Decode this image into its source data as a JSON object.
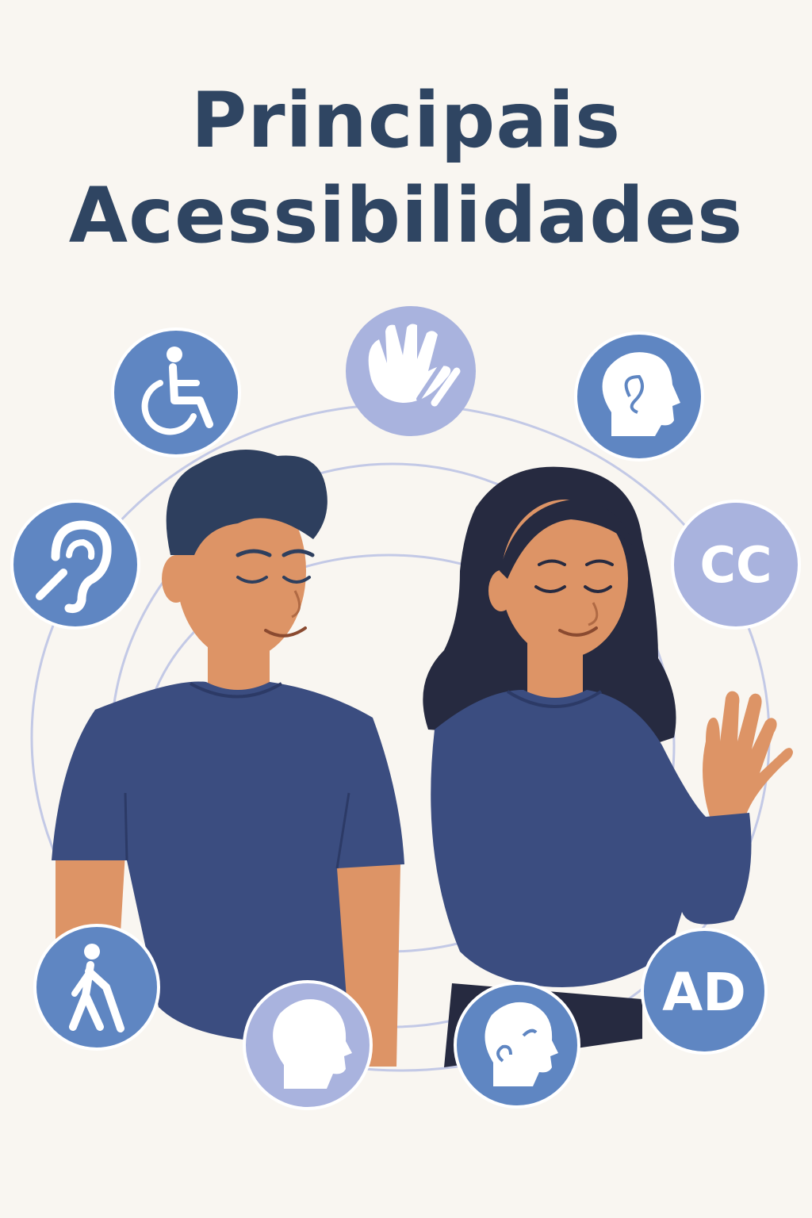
{
  "header": {
    "title_line1": "Principais",
    "title_line2": "Acessibilidades"
  },
  "icons": {
    "captions_label": "CC",
    "audio_description_label": "AD"
  },
  "colors": {
    "background": "#f9f6f1",
    "title": "#2f4562",
    "icon_blue": "#5f86c2",
    "icon_lavender": "#a9b3de",
    "shirt": "#3b4d80",
    "skin": "#dd9466",
    "hair_man": "#2e3f5e",
    "hair_woman": "#262a40",
    "ring": "#c3c9e6"
  }
}
